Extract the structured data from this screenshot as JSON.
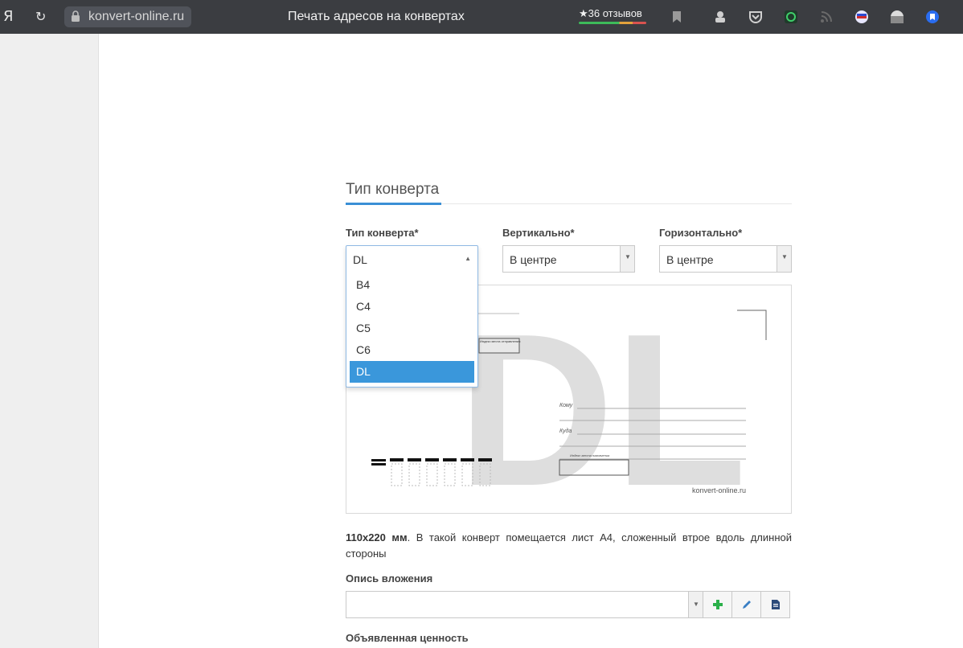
{
  "browser": {
    "logo": "Я",
    "url": "konvert-online.ru",
    "tab_title": "Печать адресов на конвертах",
    "reviews": "★36 отзывов"
  },
  "section": {
    "title": "Тип конверта"
  },
  "fields": {
    "envelope_type_label": "Тип конверта*",
    "vertical_label": "Вертикально*",
    "horizontal_label": "Горизонтально*",
    "envelope_type_value": "DL",
    "vertical_value": "В центре",
    "horizontal_value": "В центре"
  },
  "dropdown": {
    "options": [
      "B4",
      "C4",
      "C5",
      "C6",
      "DL"
    ],
    "selected": "DL"
  },
  "envelope_preview": {
    "big_label": "DL",
    "sender_box": "Индекс места отправления",
    "to_label": "Кому",
    "where_label": "Куда",
    "dest_index_label": "Индекс места назначения",
    "site": "konvert-online.ru"
  },
  "description": {
    "size": "110x220 мм",
    "text": ". В такой конверт помещается лист А4, сложенный втрое вдоль длинной стороны"
  },
  "inventory": {
    "label": "Опись вложения",
    "value": ""
  },
  "declared_value": {
    "label": "Объявленная ценность"
  },
  "colors": {
    "accent": "#3a97db",
    "add_green": "#2bb04a",
    "edit_blue": "#3a7fc4",
    "doc_navy": "#2b4a7a"
  }
}
